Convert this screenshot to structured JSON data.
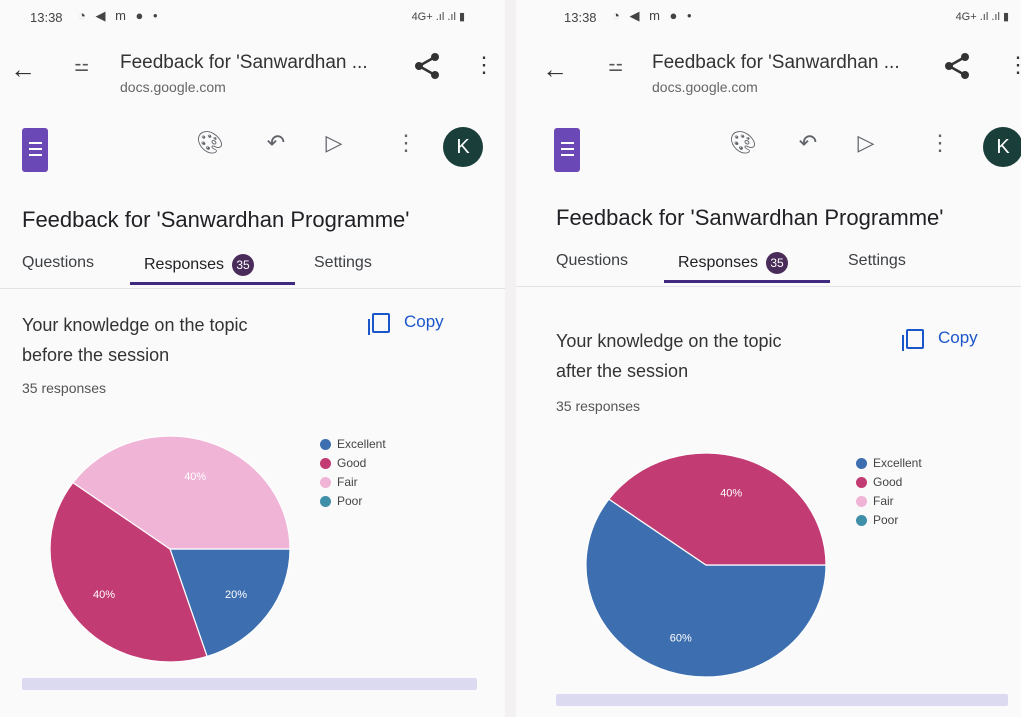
{
  "status_bar": {
    "time": "13:38",
    "icons": "◔ ◀ m ● •",
    "right": "4G+ .ıl .ıl ▮"
  },
  "browser": {
    "page_title": "Feedback for 'Sanwardhan ...",
    "domain": "docs.google.com"
  },
  "toolbar": {
    "avatar_letter": "K"
  },
  "form": {
    "title": "Feedback for 'Sanwardhan Programme'"
  },
  "tabs": {
    "questions": "Questions",
    "responses": "Responses",
    "response_count": "35",
    "settings": "Settings"
  },
  "copy_label": "Copy",
  "legend": [
    {
      "label": "Excellent",
      "color": "#3d6fb0"
    },
    {
      "label": "Good",
      "color": "#c23c73"
    },
    {
      "label": "Fair",
      "color": "#f0b4d6"
    },
    {
      "label": "Poor",
      "color": "#3f8fa8"
    }
  ],
  "left_panel": {
    "question_line1": "Your knowledge on the topic",
    "question_line2": "before the session",
    "responses_text": "35 responses"
  },
  "right_panel": {
    "question_line1": "Your knowledge on the topic",
    "question_line2": "after the session",
    "responses_text": "35 responses"
  },
  "chart_data": [
    {
      "type": "pie",
      "title": "Your knowledge on the topic before the session",
      "categories": [
        "Excellent",
        "Good",
        "Fair",
        "Poor"
      ],
      "values": [
        20,
        40,
        40,
        0
      ],
      "labels": [
        "20%",
        "40%",
        "40%",
        ""
      ],
      "legend_position": "right"
    },
    {
      "type": "pie",
      "title": "Your knowledge on the topic after the session",
      "categories": [
        "Excellent",
        "Good",
        "Fair",
        "Poor"
      ],
      "values": [
        60,
        40,
        0,
        0
      ],
      "labels": [
        "60%",
        "40%",
        "",
        ""
      ],
      "legend_position": "right"
    }
  ]
}
